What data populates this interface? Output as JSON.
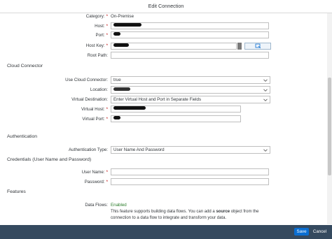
{
  "dialog": {
    "title": "Edit Connection"
  },
  "fields": {
    "category": {
      "label": "Category:",
      "value": "On-Premise"
    },
    "host": {
      "label": "Host:"
    },
    "port": {
      "label": "Port:"
    },
    "host_key": {
      "label": "Host Key:"
    },
    "root_path": {
      "label": "Root Path:"
    }
  },
  "sections": {
    "cloud_connector": "Cloud Connector",
    "authentication": "Authentication",
    "credentials": "Credentials (User Name and Password)",
    "features": "Features"
  },
  "cloud": {
    "use_cloud_connector": {
      "label": "Use Cloud Connector:",
      "value": "true"
    },
    "location": {
      "label": "Location:"
    },
    "virtual_destination": {
      "label": "Virtual Destination:",
      "value": "Enter Virtual Host and Port in Separate Fields"
    },
    "virtual_host": {
      "label": "Virtual Host:"
    },
    "virtual_port": {
      "label": "Virtual Port:"
    }
  },
  "auth": {
    "type": {
      "label": "Authentication Type:",
      "value": "User Name And Password"
    },
    "user_name": {
      "label": "User Name:"
    },
    "password": {
      "label": "Password:"
    }
  },
  "features": {
    "data_flows": {
      "label": "Data Flows:",
      "value": "Enabled"
    },
    "desc_part1": "This feature supports building data flows. You can add a ",
    "desc_bold": "source",
    "desc_part2": " object from the connection to a data flow to integrate and transform your data."
  },
  "footer": {
    "save": "Save",
    "cancel": "Cancel"
  },
  "required_mark": "*"
}
